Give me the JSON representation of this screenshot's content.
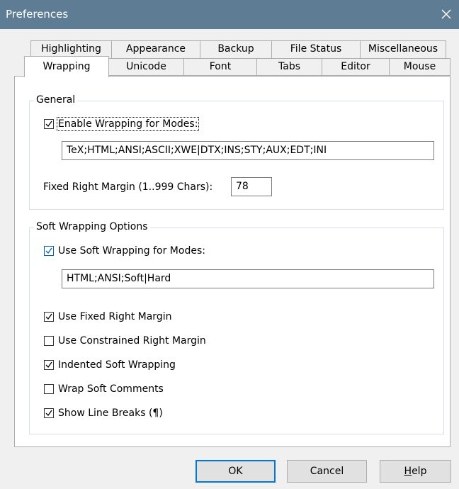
{
  "window": {
    "title": "Preferences"
  },
  "tabs": {
    "row1": [
      "Highlighting",
      "Appearance",
      "Backup",
      "File Status",
      "Miscellaneous"
    ],
    "row2": [
      "Wrapping",
      "Unicode",
      "Font",
      "Tabs",
      "Editor",
      "Mouse"
    ],
    "active": "Wrapping"
  },
  "general": {
    "legend": "General",
    "enable_wrapping_label": "Enable Wrapping for Modes:",
    "enable_wrapping_checked": true,
    "modes_value": "TeX;HTML;ANSI;ASCII;XWE|DTX;INS;STY;AUX;EDT;INI",
    "fixed_margin_label": "Fixed Right Margin (1..999 Chars):",
    "fixed_margin_value": "78"
  },
  "soft": {
    "legend": "Soft Wrapping Options",
    "use_soft_label": "Use Soft Wrapping for Modes:",
    "use_soft_checked": true,
    "soft_modes_value": "HTML;ANSI;Soft|Hard",
    "options": [
      {
        "label": "Use Fixed Right Margin",
        "checked": true
      },
      {
        "label": "Use Constrained Right Margin",
        "checked": false
      },
      {
        "label": "Indented Soft Wrapping",
        "checked": true
      },
      {
        "label": "Wrap Soft Comments",
        "checked": false
      },
      {
        "label": "Show Line Breaks (¶)",
        "checked": true
      }
    ]
  },
  "buttons": {
    "ok": "OK",
    "cancel": "Cancel",
    "help": "Help"
  },
  "colors": {
    "titlebar": "#5e7c93",
    "accent": "#0078d7",
    "background": "#f0f0f0"
  }
}
